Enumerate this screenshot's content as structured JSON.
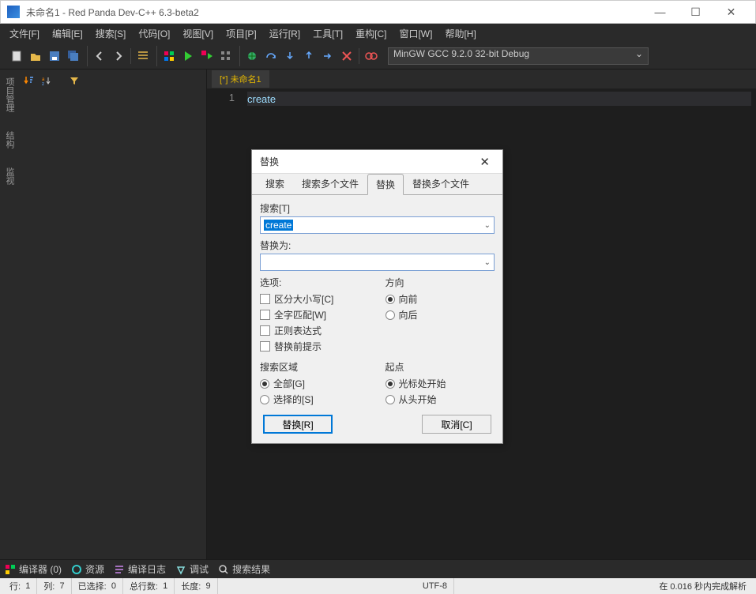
{
  "titlebar": {
    "title": "未命名1 - Red Panda Dev-C++ 6.3-beta2"
  },
  "menus": [
    "文件[F]",
    "编辑[E]",
    "搜索[S]",
    "代码[O]",
    "视图[V]",
    "项目[P]",
    "运行[R]",
    "工具[T]",
    "重构[C]",
    "窗口[W]",
    "帮助[H]"
  ],
  "compiler_select": "MinGW GCC 9.2.0 32-bit Debug",
  "side_tabs": [
    "项目管理",
    "结构",
    "监视"
  ],
  "editor": {
    "tab_label": "[*] 未命名1",
    "line_no": "1",
    "code": "create"
  },
  "bottom_tabs": [
    {
      "icon": "compiler",
      "label": "编译器 (0)",
      "color": "#ff6"
    },
    {
      "icon": "resource",
      "label": "资源",
      "color": "#6cf"
    },
    {
      "icon": "log",
      "label": "编译日志",
      "color": "#c9f"
    },
    {
      "icon": "debug",
      "label": "调试",
      "color": "#8dd"
    },
    {
      "icon": "search",
      "label": "搜索结果",
      "color": "#ccc"
    }
  ],
  "statusbar": {
    "line_label": "行:",
    "line": "1",
    "col_label": "列:",
    "col": "7",
    "sel_label": "已选择:",
    "sel": "0",
    "total_label": "总行数:",
    "total": "1",
    "len_label": "长度:",
    "len": "9",
    "encoding": "UTF-8",
    "parse": "在 0.016 秒内完成解析"
  },
  "dialog": {
    "title": "替换",
    "tabs": [
      "搜索",
      "搜索多个文件",
      "替换",
      "替换多个文件"
    ],
    "active_tab": 2,
    "search_label": "搜索[T]",
    "search_value": "create",
    "replace_label": "替换为:",
    "replace_value": "",
    "options_title": "选项:",
    "options": [
      {
        "label": "区分大小写[C]",
        "checked": false
      },
      {
        "label": "全字匹配[W]",
        "checked": false
      },
      {
        "label": "正则表达式",
        "checked": false
      },
      {
        "label": "替换前提示",
        "checked": false
      }
    ],
    "direction_title": "方向",
    "direction": [
      {
        "label": "向前",
        "checked": true
      },
      {
        "label": "向后",
        "checked": false
      }
    ],
    "scope_title": "搜索区域",
    "scope": [
      {
        "label": "全部[G]",
        "checked": true
      },
      {
        "label": "选择的[S]",
        "checked": false
      }
    ],
    "origin_title": "起点",
    "origin": [
      {
        "label": "光标处开始",
        "checked": true
      },
      {
        "label": "从头开始",
        "checked": false
      }
    ],
    "btn_replace": "替换[R]",
    "btn_cancel": "取消[C]"
  }
}
